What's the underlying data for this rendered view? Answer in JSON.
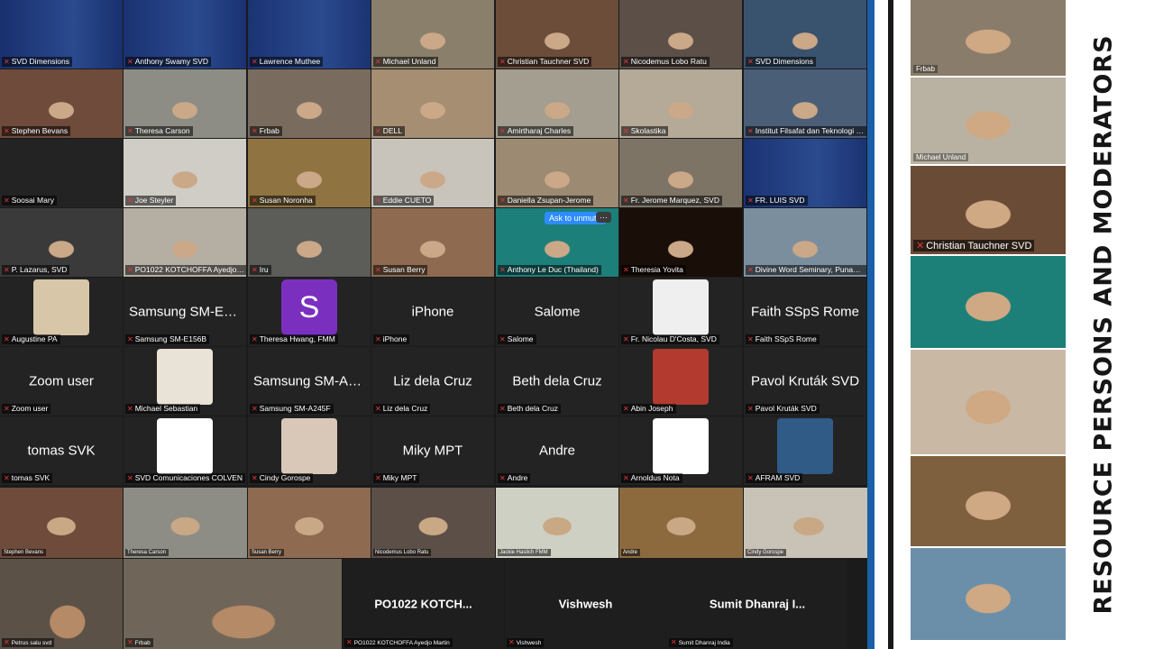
{
  "grid": {
    "rows": [
      [
        {
          "name": "SVD Dimensions",
          "type": "banner",
          "bg": "#19306e"
        },
        {
          "name": "Anthony Swamy SVD",
          "type": "banner",
          "bg": "#1a3272"
        },
        {
          "name": "Lawrence Muthee",
          "type": "banner",
          "bg": "#1b3373"
        },
        {
          "name": "Michael Unland",
          "type": "video",
          "bg": "#8a7f6a",
          "active": true
        },
        {
          "name": "Christian Tauchner SVD",
          "type": "video",
          "bg": "#6b4d3a"
        },
        {
          "name": "Nicodemus Lobo Ratu",
          "type": "video",
          "bg": "#5b4f48"
        },
        {
          "name": "SVD Dimensions",
          "type": "video",
          "bg": "#39526e"
        }
      ],
      [
        {
          "name": "Stephen Bevans",
          "type": "video",
          "bg": "#6e4b3a"
        },
        {
          "name": "Theresa Carson",
          "type": "video",
          "bg": "#8d8d86"
        },
        {
          "name": "Frbab",
          "type": "video",
          "bg": "#7a6b5f"
        },
        {
          "name": "DELL",
          "type": "video",
          "bg": "#a58e72"
        },
        {
          "name": "Amirtharaj Charles",
          "type": "video",
          "bg": "#a39e90"
        },
        {
          "name": "Skolastika",
          "type": "video",
          "bg": "#b5a998"
        },
        {
          "name": "Institut Filsafat dan Teknologi Kreatif Ledalero",
          "type": "video",
          "bg": "#4a5e78"
        }
      ],
      [
        {
          "name": "Soosai Mary",
          "type": "dark",
          "bg": "#232323"
        },
        {
          "name": "Joe Steyler",
          "type": "video",
          "bg": "#d0cdc6"
        },
        {
          "name": "Susan Noronha",
          "type": "video",
          "bg": "#8f7340"
        },
        {
          "name": "Eddie CUETO",
          "type": "video",
          "bg": "#c8c4bc"
        },
        {
          "name": "Daniella Zsupan-Jerome",
          "type": "video",
          "bg": "#9c8a72"
        },
        {
          "name": "Fr. Jerome Marquez, SVD",
          "type": "video",
          "bg": "#7d7466"
        },
        {
          "name": "FR. LUIS SVD",
          "type": "banner",
          "bg": "#1b3373"
        }
      ],
      [
        {
          "name": "P. Lazarus, SVD",
          "type": "video",
          "bg": "#3a3a3a"
        },
        {
          "name": "PO1022 KOTCHOFFA Ayedjo Martin",
          "type": "video",
          "bg": "#b5aea2"
        },
        {
          "name": "Iru",
          "type": "video",
          "bg": "#5c5c58"
        },
        {
          "name": "Susan Berry",
          "type": "video",
          "bg": "#8d6a50"
        },
        {
          "name": "Anthony Le Duc (Thailand)",
          "type": "video",
          "bg": "#1d7f7a",
          "unmute": true
        },
        {
          "name": "Theresia Yovita",
          "type": "video",
          "bg": "#1a0e08"
        },
        {
          "name": "Divine Word Seminary, Punawale",
          "type": "video",
          "bg": "#7b8e9e"
        }
      ],
      [
        {
          "name": "Augustine PA",
          "type": "photo",
          "bg": "#232323",
          "photo": "#d8c6a8"
        },
        {
          "name": "Samsung SM-E156B",
          "type": "text",
          "label": "Samsung SM-E1..."
        },
        {
          "name": "Theresa Hwang, FMM",
          "type": "letter",
          "letter": "S"
        },
        {
          "name": "iPhone",
          "type": "text",
          "label": "iPhone"
        },
        {
          "name": "Salome",
          "type": "text",
          "label": "Salome"
        },
        {
          "name": "Fr. Nicolau D'Costa, SVD",
          "type": "photo",
          "bg": "#232323",
          "photo": "#efefef"
        },
        {
          "name": "Faith SSpS Rome",
          "type": "text",
          "label": "Faith SSpS Rome"
        }
      ],
      [
        {
          "name": "Zoom user",
          "type": "text",
          "label": "Zoom user"
        },
        {
          "name": "Michael Sebastian",
          "type": "photo",
          "bg": "#232323",
          "photo": "#e9e2d6"
        },
        {
          "name": "Samsung SM-A245F",
          "type": "text",
          "label": "Samsung SM-A2..."
        },
        {
          "name": "Liz dela Cruz",
          "type": "text",
          "label": "Liz dela Cruz"
        },
        {
          "name": "Beth dela Cruz",
          "type": "text",
          "label": "Beth dela Cruz"
        },
        {
          "name": "Abin Joseph",
          "type": "photo",
          "bg": "#232323",
          "photo": "#b23a2e"
        },
        {
          "name": "Pavol Kruták SVD",
          "type": "text",
          "label": "Pavol Kruták SVD"
        }
      ],
      [
        {
          "name": "tomas SVK",
          "type": "text",
          "label": "tomas SVK"
        },
        {
          "name": "SVD Comunicaciones COLVEN",
          "type": "photo",
          "bg": "#232323",
          "photo": "#ffffff"
        },
        {
          "name": "Cindy Gorospe",
          "type": "photo",
          "bg": "#232323",
          "photo": "#d9c8b8"
        },
        {
          "name": "Miky MPT",
          "type": "text",
          "label": "Miky MPT"
        },
        {
          "name": "Andre",
          "type": "text",
          "label": "Andre"
        },
        {
          "name": "Arnoldus Nota",
          "type": "photo",
          "bg": "#232323",
          "photo": "#ffffff"
        },
        {
          "name": "AFRAM SVD",
          "type": "photo",
          "bg": "#232323",
          "photo": "#2f5b86"
        }
      ]
    ],
    "gallery_row": [
      {
        "name": "Stephen Bevans",
        "bg": "#6e4b3a"
      },
      {
        "name": "Theresa Carson",
        "bg": "#8d8d86"
      },
      {
        "name": "Susan Berry",
        "bg": "#8d6a50"
      },
      {
        "name": "Nicodemus Lobo Ratu",
        "bg": "#5b4f48"
      },
      {
        "name": "Jackie Haslich FMM",
        "bg": "#cfd0c4"
      },
      {
        "name": "Andre",
        "bg": "#8c6a3e"
      },
      {
        "name": "Cindy Gorospe",
        "bg": "#c9c2b6"
      }
    ],
    "bottom_row": [
      {
        "name": "Petrus salu svd",
        "type": "video",
        "bg": "#5b5146"
      },
      {
        "name": "Frbab",
        "type": "video",
        "bg": "#6f6558"
      },
      {
        "name": "PO1022 KOTCHOFFA Ayedjo Martin",
        "type": "text",
        "label": "PO1022 KOTCH..."
      },
      {
        "name": "Vishwesh",
        "type": "text",
        "label": "Vishwesh"
      },
      {
        "name": "Sumit Dhanraj India",
        "type": "text",
        "label": "Sumit Dhanraj I..."
      }
    ],
    "unmute_label": "Ask to unmute",
    "more_label": "···"
  },
  "side_panel": {
    "tiles": [
      {
        "name": "Frbab",
        "bg": "#8a7c6a",
        "height": 86
      },
      {
        "name": "Michael Unland",
        "bg": "#b9b2a2",
        "height": 98
      },
      {
        "name": "Christian Tauchner SVD",
        "bg": "#6a4b36",
        "height": 100,
        "big": true
      },
      {
        "name": "",
        "bg": "#1c8078",
        "height": 104
      },
      {
        "name": "",
        "bg": "#c9b9a4",
        "height": 118
      },
      {
        "name": "",
        "bg": "#7e5f3e",
        "height": 102
      },
      {
        "name": "",
        "bg": "#6b8fa8",
        "height": 104
      }
    ]
  },
  "vertical_title": "RESOURCE PERSONS AND MODERATORS",
  "colors": {
    "zoom_bg": "#1b1b1b",
    "accent_blue": "#1a5fa8",
    "mic_red": "#e23b3b",
    "title": "#161616"
  }
}
